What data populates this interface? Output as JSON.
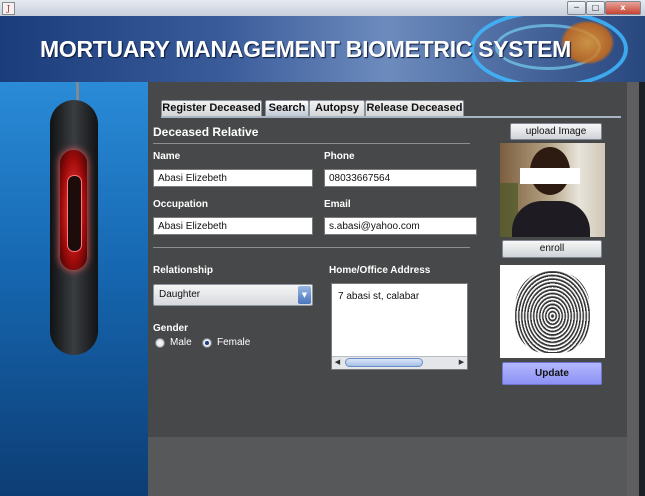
{
  "window": {
    "controls": {
      "minimize": "─",
      "maximize": "□",
      "close": "x"
    },
    "icon": "java-icon"
  },
  "banner": {
    "title": "MORTUARY MANAGEMENT BIOMETRIC SYSTEM"
  },
  "tabs": [
    {
      "label": "Register Deceased",
      "active": false
    },
    {
      "label": "Search",
      "active": true
    },
    {
      "label": "Autopsy",
      "active": false
    },
    {
      "label": "Release Deceased",
      "active": false
    }
  ],
  "form": {
    "section_title": "Deceased Relative",
    "name": {
      "label": "Name",
      "value": "Abasi Elizebeth"
    },
    "phone": {
      "label": "Phone",
      "value": "08033667564"
    },
    "occupation": {
      "label": "Occupation",
      "value": "Abasi Elizebeth"
    },
    "email": {
      "label": "Email",
      "value": "s.abasi@yahoo.com"
    },
    "relationship": {
      "label": "Relationship",
      "value": "Daughter"
    },
    "gender": {
      "label": "Gender",
      "options": [
        "Male",
        "Female"
      ],
      "selected": "Female"
    },
    "address": {
      "label": "Home/Office Address",
      "value": "7 abasi st, calabar"
    }
  },
  "buttons": {
    "upload": "upload Image",
    "enroll": "enroll",
    "update": "Update"
  },
  "colors": {
    "update_button": "#8c92f4",
    "panel": "#474849",
    "banner": "#1b3c7a"
  }
}
